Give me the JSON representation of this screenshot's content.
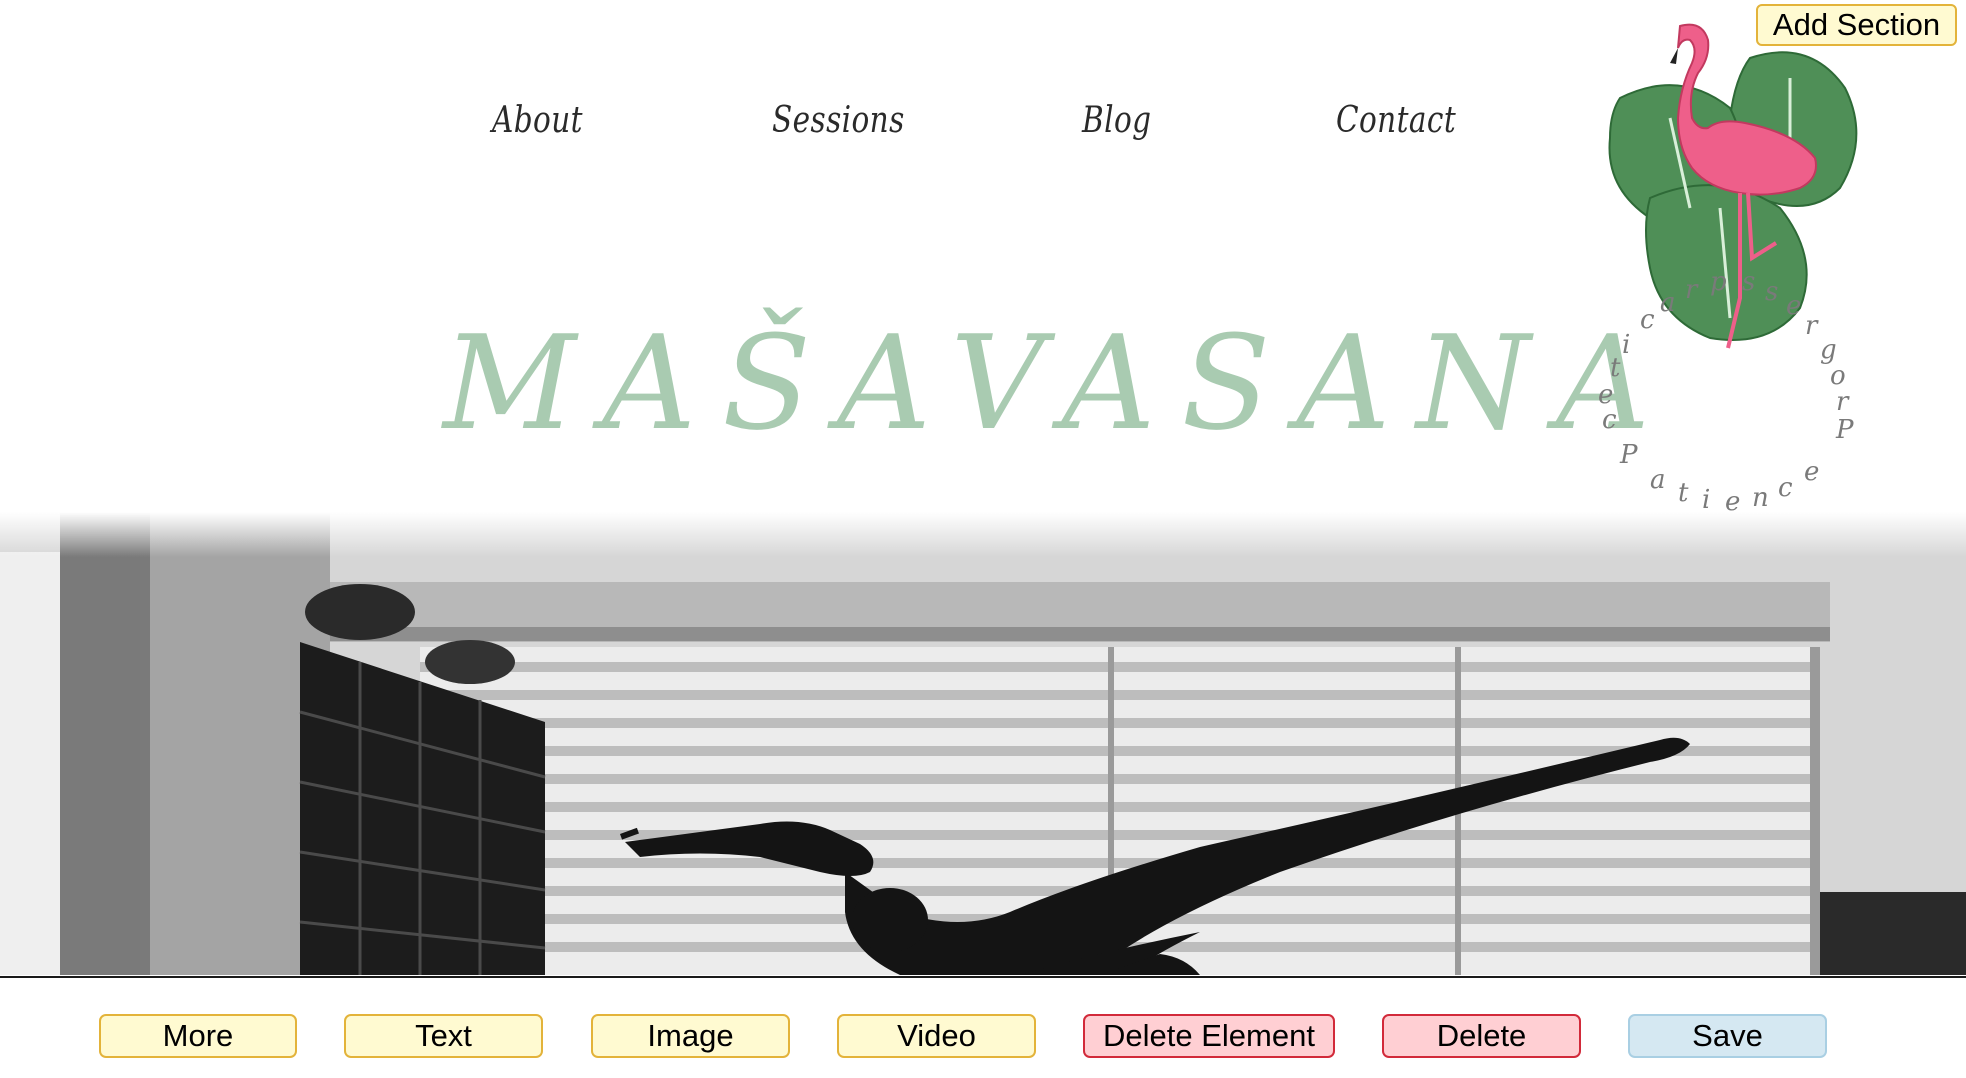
{
  "nav": {
    "items": [
      {
        "label": "About"
      },
      {
        "label": "Sessions"
      },
      {
        "label": "Blog"
      },
      {
        "label": "Contact"
      }
    ]
  },
  "site": {
    "title": "MAŠAVASANA",
    "title_color": "#a9cbb1"
  },
  "logo": {
    "icon": "flamingo-monstera-logo",
    "circle_text": "practice progress patience"
  },
  "editor": {
    "add_section_label": "Add Section",
    "toolbar": {
      "more": "More",
      "text": "Text",
      "image": "Image",
      "video": "Video",
      "delete_element": "Delete Element",
      "delete": "Delete",
      "save": "Save"
    },
    "colors": {
      "yellow_fill": "#fffad1",
      "yellow_border": "#e3b33a",
      "red_fill": "#ffcfd3",
      "red_border": "#d22a3a",
      "blue_fill": "#d5e8f2"
    }
  }
}
